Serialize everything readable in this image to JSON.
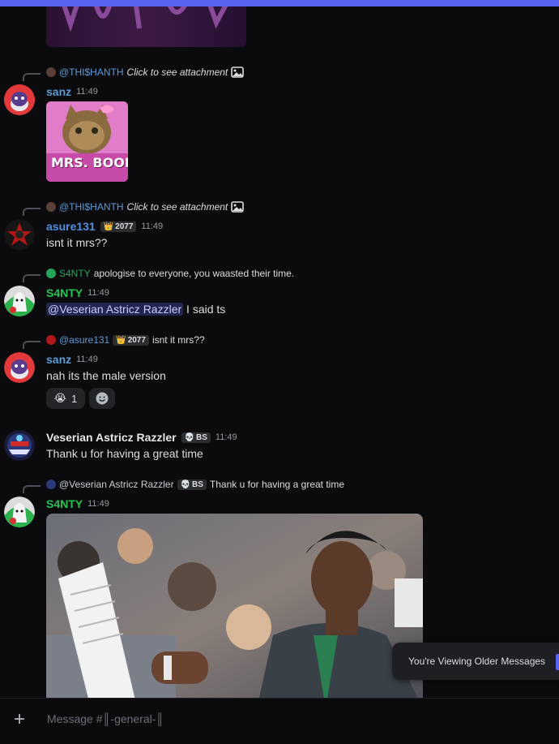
{
  "colors": {
    "accent": "#5865f2",
    "background": "#0b0b0e",
    "sanz": "#5b9bd5",
    "asure": "#4f8fe0",
    "s4nty": "#23a55a",
    "veserian": "#e3e5e8"
  },
  "messages": [
    {
      "reply": {
        "author": "@THI$HANTH",
        "text": "Click to see attachment",
        "icon": "image-icon"
      },
      "author": "sanz",
      "time": "11:49",
      "image": "cat-image",
      "image_caption": "MRS. BOOBS"
    },
    {
      "reply": {
        "author": "@THI$HANTH",
        "text": "Click to see attachment",
        "icon": "image-icon"
      },
      "author": "asure131",
      "badge": "2077",
      "time": "11:49",
      "text": "isnt it mrs??"
    },
    {
      "reply": {
        "author": "S4NTY",
        "text": "apologise to everyone, you waasted their time."
      },
      "author": "S4NTY",
      "time": "11:49",
      "mention": "@Veserian Astricz Razzler",
      "text": "I said ts"
    },
    {
      "reply": {
        "author": "@asure131",
        "badge": "2077",
        "text": "isnt it mrs??"
      },
      "author": "sanz",
      "time": "11:49",
      "text": "nah its the male version",
      "reactions": [
        {
          "emoji": "😭",
          "count": "1"
        },
        {
          "emoji": "add-reaction-icon",
          "count": ""
        }
      ]
    },
    {
      "author": "Veserian Astricz Razzler",
      "badge": "BS",
      "time": "11:49",
      "text": "Thank u for having a great time"
    },
    {
      "reply": {
        "author": "@Veserian Astricz Razzler",
        "badge": "BS",
        "text": "Thank u for having a great time"
      },
      "author": "S4NTY",
      "time": "11:49",
      "image": "basketball-player-photo"
    }
  ],
  "toast": {
    "label": "You're Viewing Older Messages"
  },
  "composer": {
    "placeholder": "Message #║-general-║",
    "plus_icon": "plus-icon"
  }
}
